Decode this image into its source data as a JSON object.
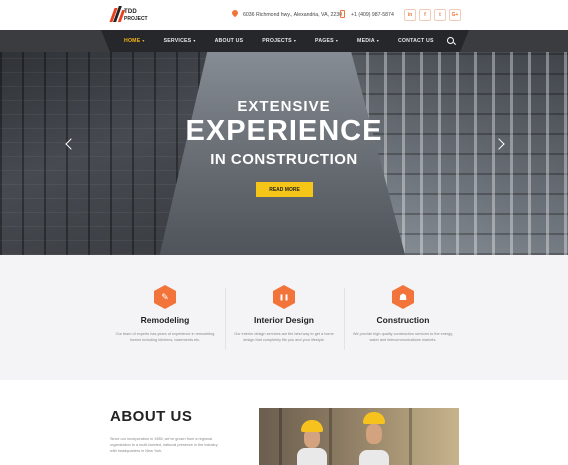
{
  "brand": {
    "name_line1": "TDD",
    "name_line2": "PROJECT",
    "accent": "#f2743a",
    "yellow": "#f5c518"
  },
  "header": {
    "address": "6036 Richmond hwy., Alexandria, VA, 2230",
    "phone": "+1 (409) 987-5874",
    "socials": [
      "in",
      "f",
      "t",
      "G+"
    ]
  },
  "nav": {
    "items": [
      {
        "label": "HOME",
        "has_menu": true,
        "active": true
      },
      {
        "label": "SERVICES",
        "has_menu": true
      },
      {
        "label": "ABOUT US",
        "has_menu": false
      },
      {
        "label": "PROJECTS",
        "has_menu": true
      },
      {
        "label": "PAGES",
        "has_menu": true
      },
      {
        "label": "MEDIA",
        "has_menu": true
      },
      {
        "label": "CONTACT US",
        "has_menu": false
      }
    ],
    "chevron": "▾"
  },
  "hero": {
    "line1": "EXTENSIVE",
    "line2": "EXPERIENCE",
    "line3": "IN CONSTRUCTION",
    "button": "READ MORE"
  },
  "services": [
    {
      "icon": "tools-icon",
      "glyph": "✎",
      "title": "Remodeling",
      "desc": "Our team of experts has years of experience in remodeling homes including kitchens, basements etc."
    },
    {
      "icon": "interior-icon",
      "glyph": "❚❚",
      "title": "Interior Design",
      "desc": "Our interior design services are the best way to get a home design that completely fits you and your lifestyle."
    },
    {
      "icon": "worker-icon",
      "glyph": "☗",
      "title": "Construction",
      "desc": "We provide high-quality construction services to the energy, water and telecommunications markets."
    }
  ],
  "about": {
    "title": "ABOUT US",
    "text": "Since our incorporation in 1985, we've grown from a regional organization to a multi-faceted, national presence in the industry with headquarters in New York."
  }
}
